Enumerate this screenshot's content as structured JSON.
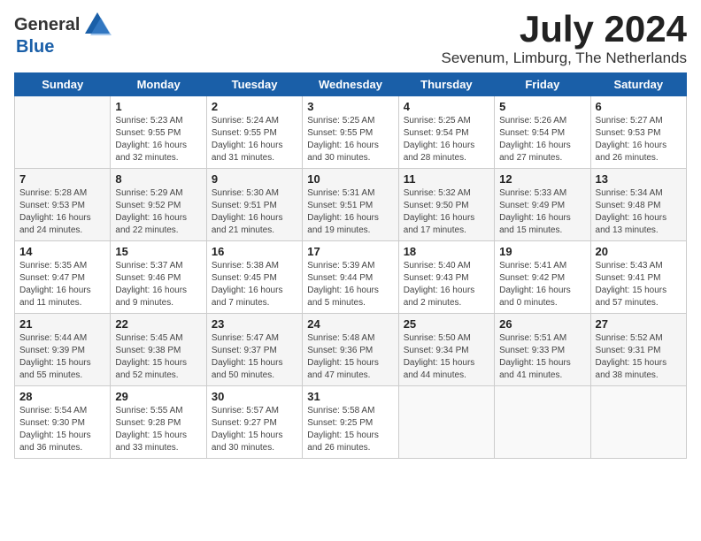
{
  "header": {
    "logo_general": "General",
    "logo_blue": "Blue",
    "month_year": "July 2024",
    "location": "Sevenum, Limburg, The Netherlands"
  },
  "days_of_week": [
    "Sunday",
    "Monday",
    "Tuesday",
    "Wednesday",
    "Thursday",
    "Friday",
    "Saturday"
  ],
  "weeks": [
    [
      {
        "day": "",
        "info": ""
      },
      {
        "day": "1",
        "info": "Sunrise: 5:23 AM\nSunset: 9:55 PM\nDaylight: 16 hours\nand 32 minutes."
      },
      {
        "day": "2",
        "info": "Sunrise: 5:24 AM\nSunset: 9:55 PM\nDaylight: 16 hours\nand 31 minutes."
      },
      {
        "day": "3",
        "info": "Sunrise: 5:25 AM\nSunset: 9:55 PM\nDaylight: 16 hours\nand 30 minutes."
      },
      {
        "day": "4",
        "info": "Sunrise: 5:25 AM\nSunset: 9:54 PM\nDaylight: 16 hours\nand 28 minutes."
      },
      {
        "day": "5",
        "info": "Sunrise: 5:26 AM\nSunset: 9:54 PM\nDaylight: 16 hours\nand 27 minutes."
      },
      {
        "day": "6",
        "info": "Sunrise: 5:27 AM\nSunset: 9:53 PM\nDaylight: 16 hours\nand 26 minutes."
      }
    ],
    [
      {
        "day": "7",
        "info": "Sunrise: 5:28 AM\nSunset: 9:53 PM\nDaylight: 16 hours\nand 24 minutes."
      },
      {
        "day": "8",
        "info": "Sunrise: 5:29 AM\nSunset: 9:52 PM\nDaylight: 16 hours\nand 22 minutes."
      },
      {
        "day": "9",
        "info": "Sunrise: 5:30 AM\nSunset: 9:51 PM\nDaylight: 16 hours\nand 21 minutes."
      },
      {
        "day": "10",
        "info": "Sunrise: 5:31 AM\nSunset: 9:51 PM\nDaylight: 16 hours\nand 19 minutes."
      },
      {
        "day": "11",
        "info": "Sunrise: 5:32 AM\nSunset: 9:50 PM\nDaylight: 16 hours\nand 17 minutes."
      },
      {
        "day": "12",
        "info": "Sunrise: 5:33 AM\nSunset: 9:49 PM\nDaylight: 16 hours\nand 15 minutes."
      },
      {
        "day": "13",
        "info": "Sunrise: 5:34 AM\nSunset: 9:48 PM\nDaylight: 16 hours\nand 13 minutes."
      }
    ],
    [
      {
        "day": "14",
        "info": "Sunrise: 5:35 AM\nSunset: 9:47 PM\nDaylight: 16 hours\nand 11 minutes."
      },
      {
        "day": "15",
        "info": "Sunrise: 5:37 AM\nSunset: 9:46 PM\nDaylight: 16 hours\nand 9 minutes."
      },
      {
        "day": "16",
        "info": "Sunrise: 5:38 AM\nSunset: 9:45 PM\nDaylight: 16 hours\nand 7 minutes."
      },
      {
        "day": "17",
        "info": "Sunrise: 5:39 AM\nSunset: 9:44 PM\nDaylight: 16 hours\nand 5 minutes."
      },
      {
        "day": "18",
        "info": "Sunrise: 5:40 AM\nSunset: 9:43 PM\nDaylight: 16 hours\nand 2 minutes."
      },
      {
        "day": "19",
        "info": "Sunrise: 5:41 AM\nSunset: 9:42 PM\nDaylight: 16 hours\nand 0 minutes."
      },
      {
        "day": "20",
        "info": "Sunrise: 5:43 AM\nSunset: 9:41 PM\nDaylight: 15 hours\nand 57 minutes."
      }
    ],
    [
      {
        "day": "21",
        "info": "Sunrise: 5:44 AM\nSunset: 9:39 PM\nDaylight: 15 hours\nand 55 minutes."
      },
      {
        "day": "22",
        "info": "Sunrise: 5:45 AM\nSunset: 9:38 PM\nDaylight: 15 hours\nand 52 minutes."
      },
      {
        "day": "23",
        "info": "Sunrise: 5:47 AM\nSunset: 9:37 PM\nDaylight: 15 hours\nand 50 minutes."
      },
      {
        "day": "24",
        "info": "Sunrise: 5:48 AM\nSunset: 9:36 PM\nDaylight: 15 hours\nand 47 minutes."
      },
      {
        "day": "25",
        "info": "Sunrise: 5:50 AM\nSunset: 9:34 PM\nDaylight: 15 hours\nand 44 minutes."
      },
      {
        "day": "26",
        "info": "Sunrise: 5:51 AM\nSunset: 9:33 PM\nDaylight: 15 hours\nand 41 minutes."
      },
      {
        "day": "27",
        "info": "Sunrise: 5:52 AM\nSunset: 9:31 PM\nDaylight: 15 hours\nand 38 minutes."
      }
    ],
    [
      {
        "day": "28",
        "info": "Sunrise: 5:54 AM\nSunset: 9:30 PM\nDaylight: 15 hours\nand 36 minutes."
      },
      {
        "day": "29",
        "info": "Sunrise: 5:55 AM\nSunset: 9:28 PM\nDaylight: 15 hours\nand 33 minutes."
      },
      {
        "day": "30",
        "info": "Sunrise: 5:57 AM\nSunset: 9:27 PM\nDaylight: 15 hours\nand 30 minutes."
      },
      {
        "day": "31",
        "info": "Sunrise: 5:58 AM\nSunset: 9:25 PM\nDaylight: 15 hours\nand 26 minutes."
      },
      {
        "day": "",
        "info": ""
      },
      {
        "day": "",
        "info": ""
      },
      {
        "day": "",
        "info": ""
      }
    ]
  ]
}
